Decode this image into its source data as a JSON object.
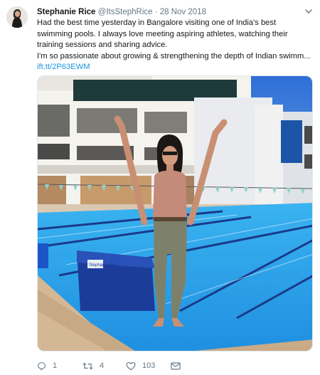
{
  "tweet": {
    "author_name": "Stephanie Rice",
    "handle": "@ItsStephRice",
    "separator": "·",
    "date": "28 Nov 2018",
    "text_line_1": "Had the best time yesterday in Bangalore visiting one of India's best swimming pools. I always love meeting aspiring athletes, watching their training sessions and sharing advice.",
    "text_line_2": "I'm so passionate about growing & strengthening the depth of Indian swimm...",
    "link": "ift.tt/2P63EWM",
    "colors": {
      "link": "#1b95e0",
      "muted": "#657786",
      "text": "#14171a"
    }
  },
  "photo": {
    "banner_text": "Stephanie Rice"
  },
  "actions": {
    "replies": "1",
    "retweets": "4",
    "likes": "103",
    "icons": [
      "reply-icon",
      "retweet-icon",
      "like-icon",
      "dm-icon"
    ]
  }
}
